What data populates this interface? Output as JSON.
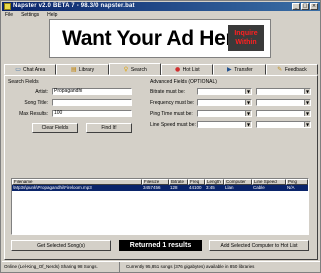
{
  "window": {
    "title": "Napster v2.0 BETA 7 - 98.3/0 napster.bat",
    "min": "_",
    "max": "□",
    "close": "×"
  },
  "menu": {
    "file": "File",
    "settings": "Settings",
    "help": "Help"
  },
  "banner": {
    "ad_text": "Want Your Ad Here?",
    "inquire_line1": "Inquire",
    "inquire_line2": "Within"
  },
  "tabs": [
    {
      "label": "Chat Area",
      "icon": "chat-icon"
    },
    {
      "label": "Library",
      "icon": "library-icon"
    },
    {
      "label": "Search",
      "icon": "search-icon"
    },
    {
      "label": "Hot List",
      "icon": "hotlist-icon"
    },
    {
      "label": "Transfer",
      "icon": "transfer-icon"
    },
    {
      "label": "Feedback",
      "icon": "feedback-icon"
    }
  ],
  "search": {
    "group_label": "Search Fields",
    "artist_label": "Artist:",
    "artist_value": "Propagandhi",
    "song_label": "Song Title:",
    "song_value": "",
    "max_label": "Max Results:",
    "max_value": "100",
    "clear_button": "Clear Fields",
    "find_button": "Find It!"
  },
  "advanced": {
    "group_label": "Advanced Fields (OPTIONAL)",
    "bitrate_label": "Bitrate must be:",
    "frequency_label": "Frequency must be:",
    "ping_label": "Ping Time must be:",
    "linespeed_label": "Line Speed must be:"
  },
  "results": {
    "columns": [
      "Filename",
      "Filesize",
      "Bitrate",
      "Freq",
      "Length",
      "Computer",
      "Line Speed",
      "Ping"
    ],
    "rows": [
      [
        "\\Mp3s\\punk\\Propagandhi\\Fireloom.mp3",
        "3457456",
        "128",
        "44100",
        "3:45",
        "Llan",
        "Cable",
        "N/A"
      ]
    ]
  },
  "bottom": {
    "get_button": "Get Selected Song(s)",
    "returned": "Returned 1 results",
    "add_button": "Add Selected Computer to Hot List"
  },
  "status": {
    "left": "Online (Lel-King_Of_Nerds) Sharing 98 Songs.",
    "right": "Currently 95,851 songs (376 gigabytes) available in 850 libraries"
  },
  "colors": {
    "titlebar": "#0a246a",
    "selection": "#0a246a",
    "inquire": "#ff2020"
  }
}
